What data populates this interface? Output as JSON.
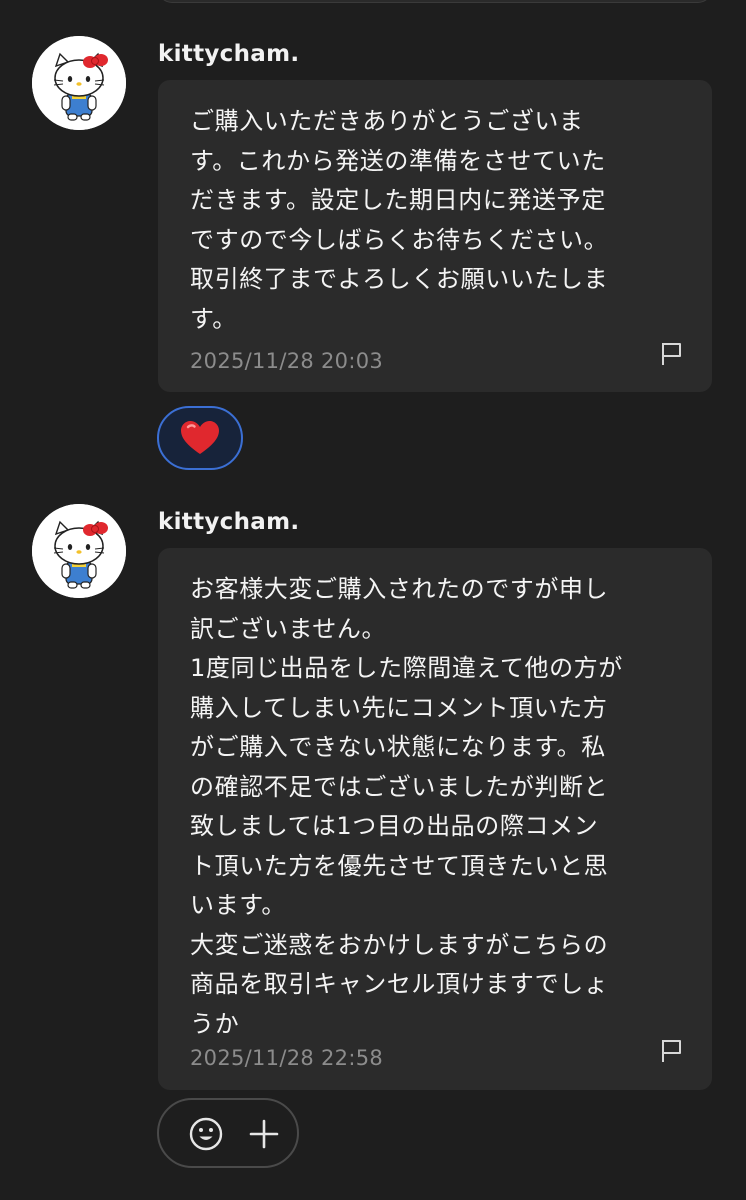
{
  "messages": [
    {
      "sender": "kittycham.",
      "text": "ご購入いただきありがとうございま\nす。これから発送の準備をさせていた\nだきます。設定した期日内に発送予定\nですので今しばらくお待ちください。\n取引終了までよろしくお願いいたしま\nす。",
      "timestamp": "2025/11/28 20:03",
      "reaction": "heart"
    },
    {
      "sender": "kittycham.",
      "text": "お客様大変ご購入されたのですが申し\n訳ございません。\n1度同じ出品をした際間違えて他の方が\n購入してしまい先にコメント頂いた方\nがご購入できない状態になります。私\nの確認不足ではございましたが判断と\n致しましては1つ目の出品の際コメン\nト頂いた方を優先させて頂きたいと思\nいます。\n大変ご迷惑をおかけしますがこちらの\n商品を取引キャンセル頂けますでしょ\nうか",
      "timestamp": "2025/11/28 22:58"
    }
  ],
  "icons": {
    "avatar": "hello-kitty-avatar-icon",
    "flag": "flag-icon",
    "reaction": "heart-icon",
    "emoji": "smiley-face-icon",
    "add": "plus-icon"
  },
  "colors": {
    "background": "#1e1e1e",
    "bubble": "#2b2b2b",
    "timestamp": "#8c8c8c",
    "reaction_border": "#3b6fd4",
    "heart": "#e0282e"
  }
}
